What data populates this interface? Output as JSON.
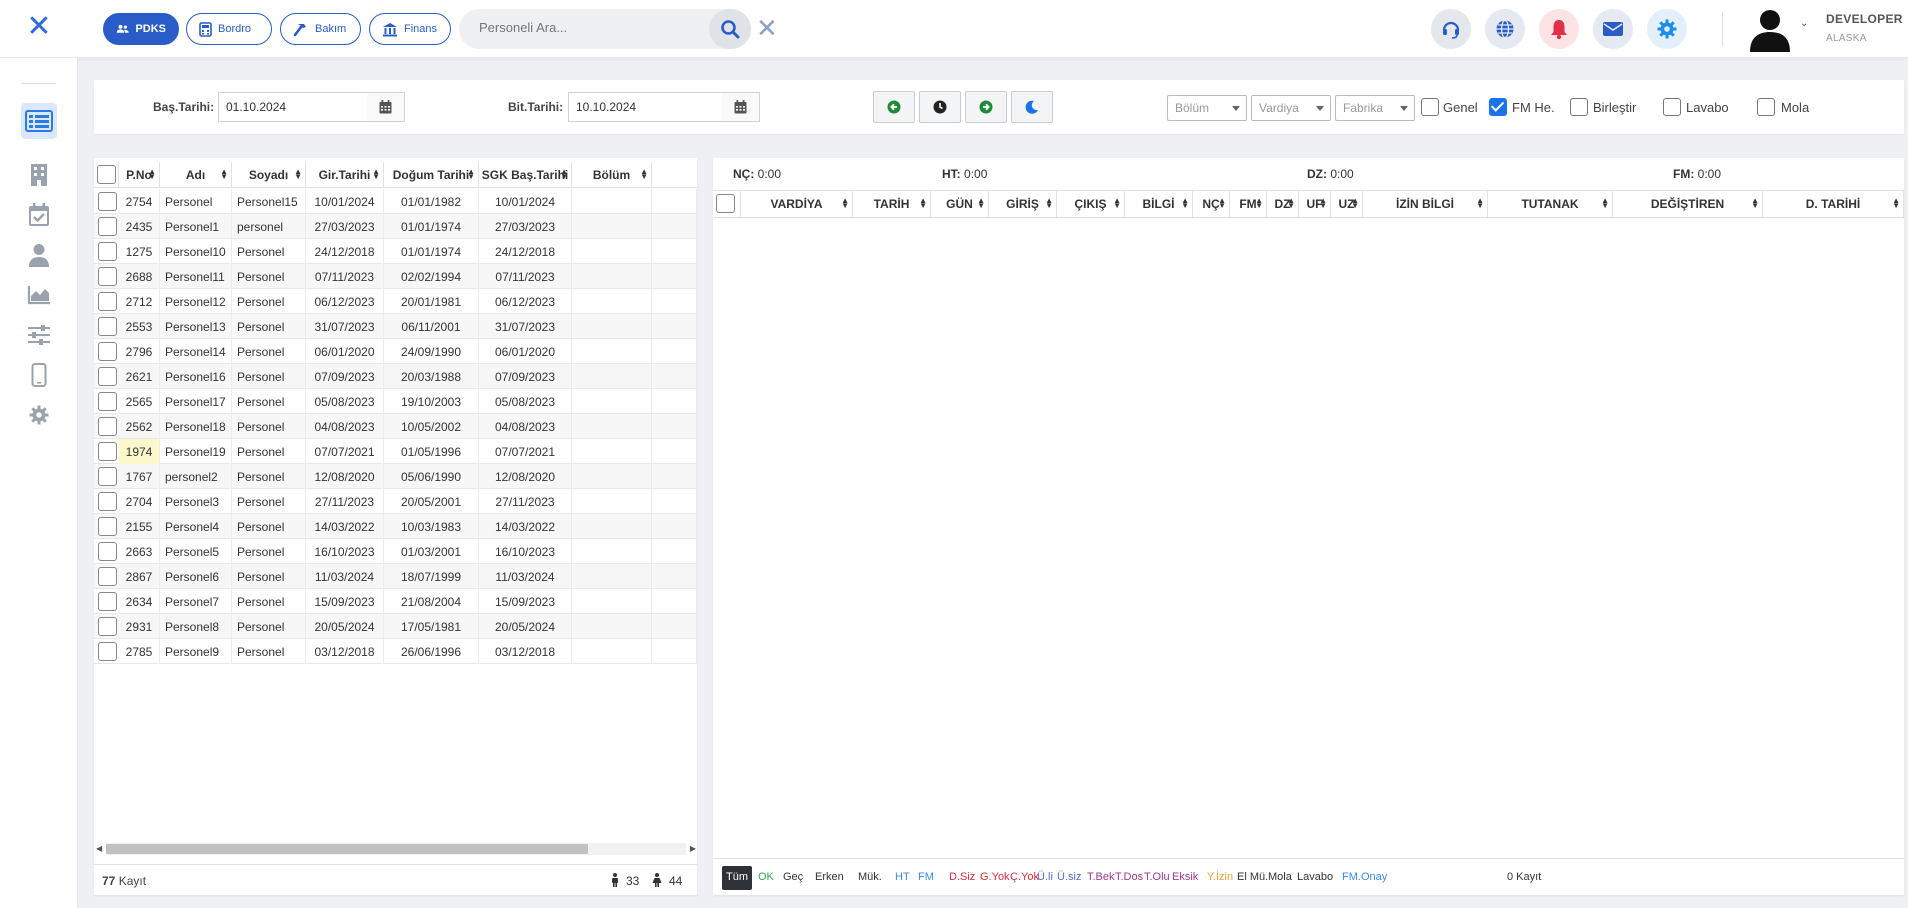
{
  "header": {
    "modules": [
      {
        "label": "PDKS",
        "icon": "users-icon",
        "active": true
      },
      {
        "label": "Bordro",
        "icon": "calculator-icon",
        "active": false
      },
      {
        "label": "Bakım",
        "icon": "hammer-icon",
        "active": false
      },
      {
        "label": "Finans",
        "icon": "bank-icon",
        "active": false
      }
    ],
    "search_placeholder": "Personeli Ara...",
    "actions": [
      "headset-icon",
      "globe-icon",
      "bell-icon",
      "mail-icon",
      "gear-icon"
    ],
    "user": {
      "name": "DEVELOPER",
      "subtitle": "ALASKA"
    }
  },
  "sidebar": {
    "items": [
      "list-icon",
      "building-icon",
      "calendar-check-icon",
      "user-icon",
      "area-chart-icon",
      "sliders-icon",
      "mobile-icon",
      "gear-icon"
    ],
    "active_index": 0
  },
  "filters": {
    "start_label": "Baş.Tarihi:",
    "start_value": "01.10.2024",
    "end_label": "Bit.Tarihi:",
    "end_value": "10.10.2024",
    "nav_buttons": [
      "arrow-left-icon",
      "clock-icon",
      "arrow-right-icon",
      "moon-icon"
    ],
    "selects": [
      "Bölüm",
      "Vardiya",
      "Fabrika"
    ],
    "checkboxes": [
      {
        "label": "Genel",
        "checked": false
      },
      {
        "label": "FM He.",
        "checked": true
      },
      {
        "label": "Birleştir",
        "checked": false
      },
      {
        "label": "Lavabo",
        "checked": false
      },
      {
        "label": "Mola",
        "checked": false
      }
    ]
  },
  "personnel_table": {
    "columns": [
      "P.No",
      "Adı",
      "Soyadı",
      "Gir.Tarihi",
      "Doğum Tarihi",
      "SGK Baş.Tarihi",
      "Bölüm"
    ],
    "rows": [
      [
        "2754",
        "Personel",
        "Personel15",
        "10/01/2024",
        "01/01/1982",
        "10/01/2024",
        ""
      ],
      [
        "2435",
        "Personel1",
        "personel",
        "27/03/2023",
        "01/01/1974",
        "27/03/2023",
        ""
      ],
      [
        "1275",
        "Personel10",
        "Personel",
        "24/12/2018",
        "01/01/1974",
        "24/12/2018",
        ""
      ],
      [
        "2688",
        "Personel11",
        "Personel",
        "07/11/2023",
        "02/02/1994",
        "07/11/2023",
        ""
      ],
      [
        "2712",
        "Personel12",
        "Personel",
        "06/12/2023",
        "20/01/1981",
        "06/12/2023",
        ""
      ],
      [
        "2553",
        "Personel13",
        "Personel",
        "31/07/2023",
        "06/11/2001",
        "31/07/2023",
        ""
      ],
      [
        "2796",
        "Personel14",
        "Personel",
        "06/01/2020",
        "24/09/1990",
        "06/01/2020",
        ""
      ],
      [
        "2621",
        "Personel16",
        "Personel",
        "07/09/2023",
        "20/03/1988",
        "07/09/2023",
        ""
      ],
      [
        "2565",
        "Personel17",
        "Personel",
        "05/08/2023",
        "19/10/2003",
        "05/08/2023",
        ""
      ],
      [
        "2562",
        "Personel18",
        "Personel",
        "04/08/2023",
        "10/05/2002",
        "04/08/2023",
        ""
      ],
      [
        "1974",
        "Personel19",
        "Personel",
        "07/07/2021",
        "01/05/1996",
        "07/07/2021",
        ""
      ],
      [
        "1767",
        "personel2",
        "Personel",
        "12/08/2020",
        "05/06/1990",
        "12/08/2020",
        ""
      ],
      [
        "2704",
        "Personel3",
        "Personel",
        "27/11/2023",
        "20/05/2001",
        "27/11/2023",
        ""
      ],
      [
        "2155",
        "Personel4",
        "Personel",
        "14/03/2022",
        "10/03/1983",
        "14/03/2022",
        ""
      ],
      [
        "2663",
        "Personel5",
        "Personel",
        "16/10/2023",
        "01/03/2001",
        "16/10/2023",
        ""
      ],
      [
        "2867",
        "Personel6",
        "Personel",
        "11/03/2024",
        "18/07/1999",
        "11/03/2024",
        ""
      ],
      [
        "2634",
        "Personel7",
        "Personel",
        "15/09/2023",
        "21/08/2004",
        "15/09/2023",
        ""
      ],
      [
        "2931",
        "Personel8",
        "Personel",
        "20/05/2024",
        "17/05/1981",
        "20/05/2024",
        ""
      ],
      [
        "2785",
        "Personel9",
        "Personel",
        "03/12/2018",
        "26/06/1996",
        "03/12/2018",
        ""
      ]
    ],
    "highlighted_row": 10,
    "footer": {
      "count": "77",
      "count_suffix": " Kayıt",
      "male_count": "33",
      "female_count": "44"
    }
  },
  "attendance_panel": {
    "stats": [
      {
        "label": "NÇ:",
        "value": "0:00"
      },
      {
        "label": "HT:",
        "value": "0:00"
      },
      {
        "label": "DZ:",
        "value": "0:00"
      },
      {
        "label": "FM:",
        "value": "0:00"
      }
    ],
    "columns": [
      "VARDİYA",
      "TARİH",
      "GÜN",
      "GİRİŞ",
      "ÇIKIŞ",
      "BİLGİ",
      "NÇ",
      "FM",
      "DZ",
      "UF",
      "UZ",
      "İZİN BİLGİ",
      "TUTANAK",
      "DEĞİŞTİREN",
      "D. TARİHİ"
    ],
    "status_tags": [
      {
        "label": "Tüm",
        "color": "#ffffff"
      },
      {
        "label": "OK",
        "color": "#2fa84f"
      },
      {
        "label": "Geç",
        "color": "#333333"
      },
      {
        "label": "Erken",
        "color": "#333333"
      },
      {
        "label": "Mük.",
        "color": "#333333"
      },
      {
        "label": "HT",
        "color": "#3b8be0"
      },
      {
        "label": "FM",
        "color": "#3b8be0"
      },
      {
        "label": "D.Siz",
        "color": "#d22f3f"
      },
      {
        "label": "G.Yok",
        "color": "#d22f3f"
      },
      {
        "label": "Ç.Yok",
        "color": "#d22f3f"
      },
      {
        "label": "Ü.li",
        "color": "#5b6bd0"
      },
      {
        "label": "Ü.siz",
        "color": "#5b6bd0"
      },
      {
        "label": "T.Bek",
        "color": "#9b3b8a"
      },
      {
        "label": "T.Dos",
        "color": "#9b3b8a"
      },
      {
        "label": "T.Olu",
        "color": "#9b3b8a"
      },
      {
        "label": "Eksik",
        "color": "#9b3b8a"
      },
      {
        "label": "Y.İzin",
        "color": "#e8a33a"
      },
      {
        "label": "El Mü.",
        "color": "#333333"
      },
      {
        "label": "Mola",
        "color": "#333333"
      },
      {
        "label": "Lavabo",
        "color": "#333333"
      },
      {
        "label": "FM.Onay",
        "color": "#3b8be0"
      },
      {
        "label": "0 Kayıt",
        "color": "#333333"
      }
    ]
  }
}
